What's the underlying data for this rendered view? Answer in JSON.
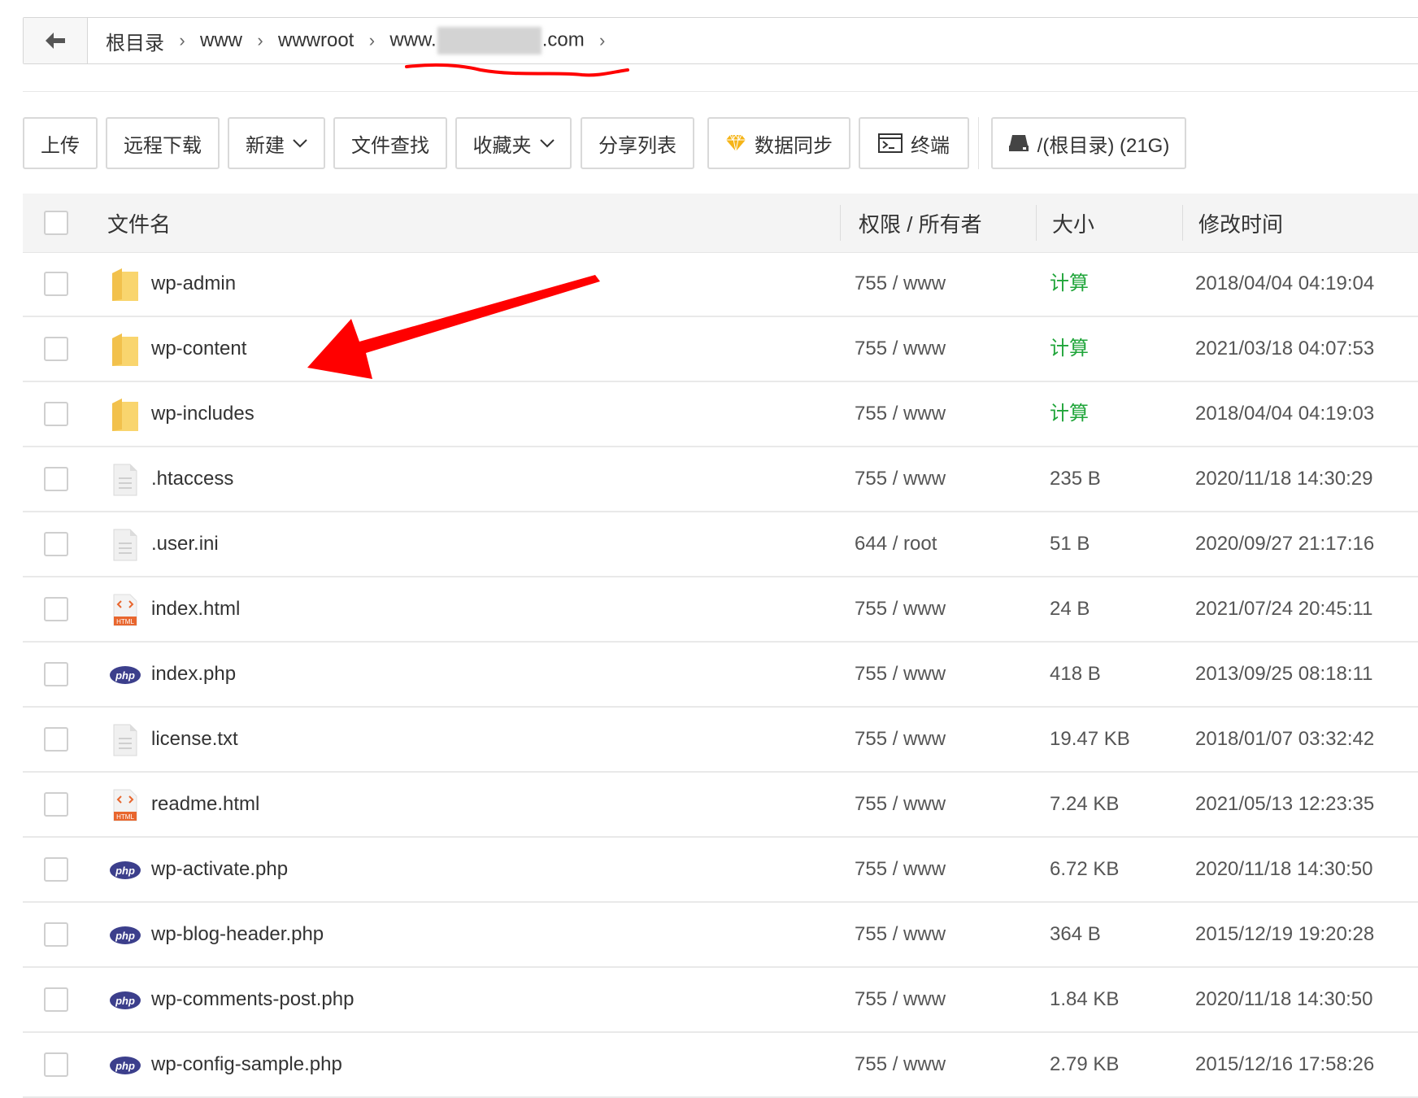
{
  "breadcrumb": {
    "items": [
      {
        "label": "根目录"
      },
      {
        "label": "www"
      },
      {
        "label": "wwwroot"
      }
    ],
    "current": {
      "prefix": "www.",
      "suffix": ".com"
    }
  },
  "toolbar": {
    "upload": "上传",
    "remote_download": "远程下载",
    "new": "新建",
    "file_search": "文件查找",
    "favorites": "收藏夹",
    "share_list": "分享列表",
    "data_sync": "数据同步",
    "terminal": "终端",
    "disk": "/(根目录) (21G)"
  },
  "table": {
    "headers": {
      "name": "文件名",
      "permission_owner": "权限 / 所有者",
      "size": "大小",
      "modified": "修改时间"
    },
    "rows": [
      {
        "name": "wp-admin",
        "icon": "folder",
        "perm": "755 / www",
        "size": "计算",
        "size_is_action": true,
        "modified": "2018/04/04 04:19:04"
      },
      {
        "name": "wp-content",
        "icon": "folder",
        "perm": "755 / www",
        "size": "计算",
        "size_is_action": true,
        "modified": "2021/03/18 04:07:53"
      },
      {
        "name": "wp-includes",
        "icon": "folder",
        "perm": "755 / www",
        "size": "计算",
        "size_is_action": true,
        "modified": "2018/04/04 04:19:03"
      },
      {
        "name": ".htaccess",
        "icon": "text",
        "perm": "755 / www",
        "size": "235 B",
        "size_is_action": false,
        "modified": "2020/11/18 14:30:29"
      },
      {
        "name": ".user.ini",
        "icon": "text",
        "perm": "644 / root",
        "size": "51 B",
        "size_is_action": false,
        "modified": "2020/09/27 21:17:16"
      },
      {
        "name": "index.html",
        "icon": "html",
        "perm": "755 / www",
        "size": "24 B",
        "size_is_action": false,
        "modified": "2021/07/24 20:45:11"
      },
      {
        "name": "index.php",
        "icon": "php",
        "perm": "755 / www",
        "size": "418 B",
        "size_is_action": false,
        "modified": "2013/09/25 08:18:11"
      },
      {
        "name": "license.txt",
        "icon": "text",
        "perm": "755 / www",
        "size": "19.47 KB",
        "size_is_action": false,
        "modified": "2018/01/07 03:32:42"
      },
      {
        "name": "readme.html",
        "icon": "html",
        "perm": "755 / www",
        "size": "7.24 KB",
        "size_is_action": false,
        "modified": "2021/05/13 12:23:35"
      },
      {
        "name": "wp-activate.php",
        "icon": "php",
        "perm": "755 / www",
        "size": "6.72 KB",
        "size_is_action": false,
        "modified": "2020/11/18 14:30:50"
      },
      {
        "name": "wp-blog-header.php",
        "icon": "php",
        "perm": "755 / www",
        "size": "364 B",
        "size_is_action": false,
        "modified": "2015/12/19 19:20:28"
      },
      {
        "name": "wp-comments-post.php",
        "icon": "php",
        "perm": "755 / www",
        "size": "1.84 KB",
        "size_is_action": false,
        "modified": "2020/11/18 14:30:50"
      },
      {
        "name": "wp-config-sample.php",
        "icon": "php",
        "perm": "755 / www",
        "size": "2.79 KB",
        "size_is_action": false,
        "modified": "2015/12/16 17:58:26"
      }
    ]
  },
  "icons": {
    "html_badge": "HTML",
    "php_badge": "php"
  },
  "colors": {
    "calc_green": "#20a53a",
    "annotation_red": "#ff0000",
    "folder_yellow": "#f9d56e",
    "php_blue": "#3c3f8c",
    "html_orange": "#e8662e"
  }
}
